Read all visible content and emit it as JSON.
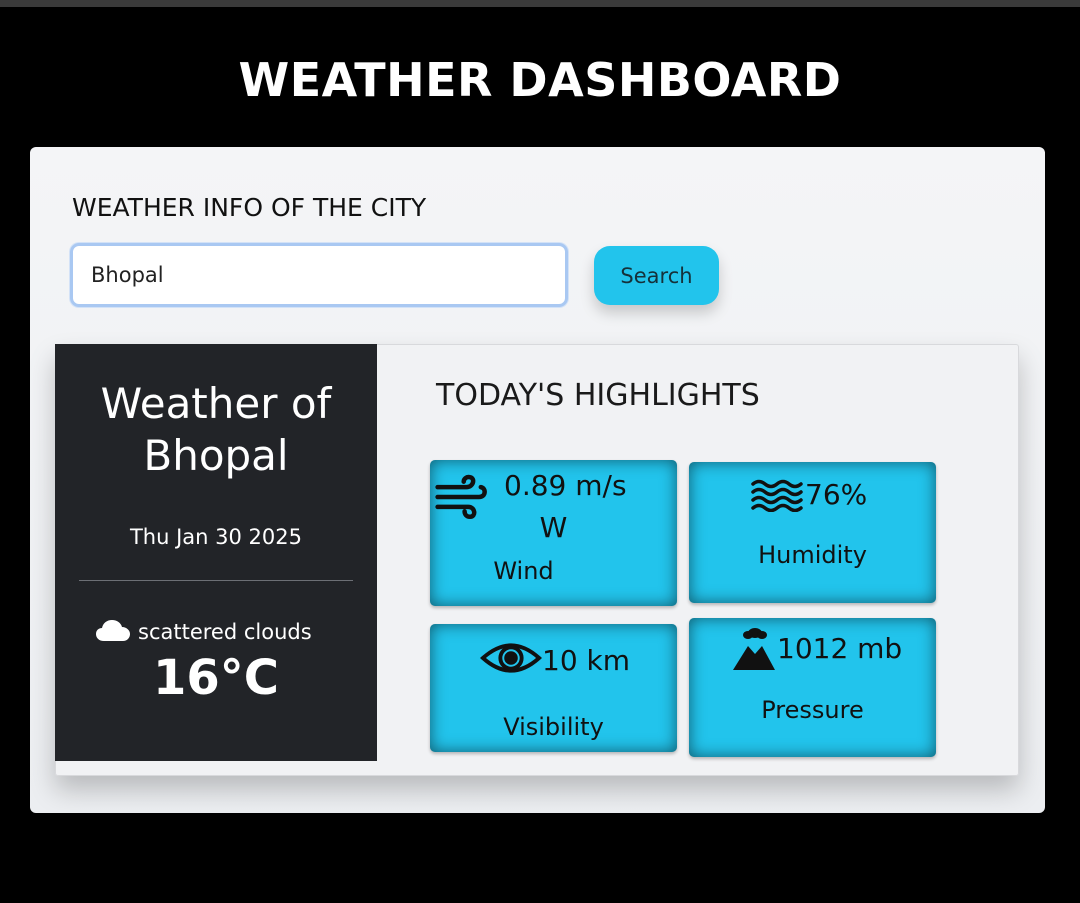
{
  "header": {
    "title": "WEATHER DASHBOARD"
  },
  "search": {
    "heading": "WEATHER INFO OF THE CITY",
    "value": "Bhopal",
    "button_label": "Search"
  },
  "current": {
    "title_line1": "Weather of",
    "city": "Bhopal",
    "date": "Thu Jan 30 2025",
    "condition": "scattered clouds",
    "condition_icon": "cloud-icon",
    "temperature": "16°C"
  },
  "highlights": {
    "title": "TODAY'S HIGHLIGHTS",
    "wind": {
      "value": "0.89 m/s",
      "direction": "W",
      "label": "Wind",
      "icon": "wind-icon"
    },
    "humidity": {
      "value": "76%",
      "label": "Humidity",
      "icon": "water-waves-icon"
    },
    "visibility": {
      "value": "10 km",
      "label": "Visibility",
      "icon": "eye-icon"
    },
    "pressure": {
      "value": "1012 mb",
      "label": "Pressure",
      "icon": "volcano-icon"
    }
  },
  "colors": {
    "background": "#000000",
    "panel": "#f1f2f4",
    "left_card": "#222428",
    "accent": "#22c4ec"
  }
}
